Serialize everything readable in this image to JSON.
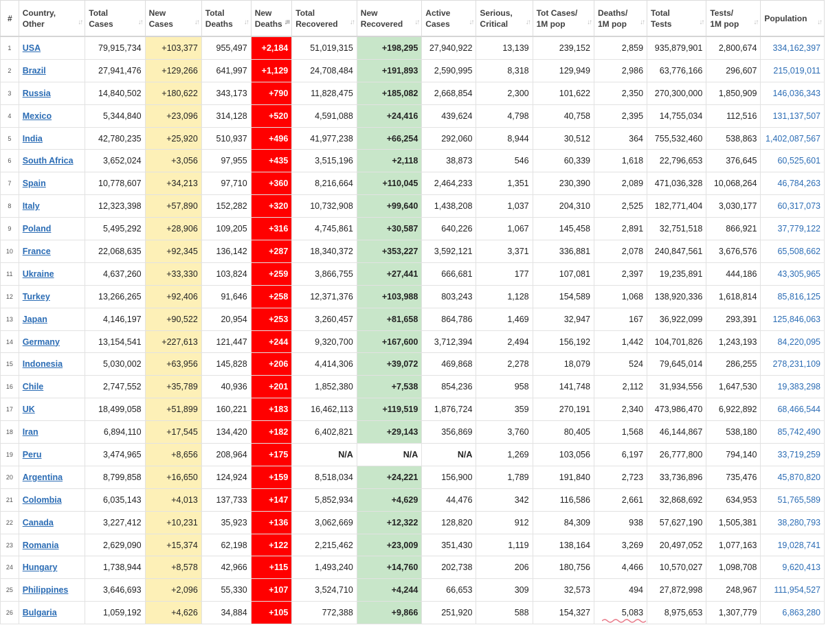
{
  "columns": [
    {
      "line1": "#",
      "line2": "",
      "sort": ""
    },
    {
      "line1": "Country,",
      "line2": "Other",
      "sort": "↓↑"
    },
    {
      "line1": "Total",
      "line2": "Cases",
      "sort": "↓↑"
    },
    {
      "line1": "New",
      "line2": "Cases",
      "sort": "↓↑"
    },
    {
      "line1": "Total",
      "line2": "Deaths",
      "sort": "↓↑"
    },
    {
      "line1": "New",
      "line2": "Deaths",
      "sort": "↓≡"
    },
    {
      "line1": "Total",
      "line2": "Recovered",
      "sort": "↓↑"
    },
    {
      "line1": "New",
      "line2": "Recovered",
      "sort": "↓↑"
    },
    {
      "line1": "Active",
      "line2": "Cases",
      "sort": "↓↑"
    },
    {
      "line1": "Serious,",
      "line2": "Critical",
      "sort": "↓↑"
    },
    {
      "line1": "Tot Cases/",
      "line2": "1M pop",
      "sort": "↓↑"
    },
    {
      "line1": "Deaths/",
      "line2": "1M pop",
      "sort": "↓↑"
    },
    {
      "line1": "Total",
      "line2": "Tests",
      "sort": "↓↑"
    },
    {
      "line1": "Tests/",
      "line2": "1M pop",
      "sort": "↓↑"
    },
    {
      "line1": "Population",
      "line2": "",
      "sort": "↓↑"
    }
  ],
  "rows": [
    {
      "rank": "1",
      "country": "USA",
      "total_cases": "79,915,734",
      "new_cases": "+103,377",
      "total_deaths": "955,497",
      "new_deaths": "+2,184",
      "total_recovered": "51,019,315",
      "new_recovered": "+198,295",
      "active_cases": "27,940,922",
      "critical": "13,139",
      "cases_per_1m": "239,152",
      "deaths_per_1m": "2,859",
      "total_tests": "935,879,901",
      "tests_per_1m": "2,800,674",
      "population": "334,162,397"
    },
    {
      "rank": "2",
      "country": "Brazil",
      "total_cases": "27,941,476",
      "new_cases": "+129,266",
      "total_deaths": "641,997",
      "new_deaths": "+1,129",
      "total_recovered": "24,708,484",
      "new_recovered": "+191,893",
      "active_cases": "2,590,995",
      "critical": "8,318",
      "cases_per_1m": "129,949",
      "deaths_per_1m": "2,986",
      "total_tests": "63,776,166",
      "tests_per_1m": "296,607",
      "population": "215,019,011"
    },
    {
      "rank": "3",
      "country": "Russia",
      "total_cases": "14,840,502",
      "new_cases": "+180,622",
      "total_deaths": "343,173",
      "new_deaths": "+790",
      "total_recovered": "11,828,475",
      "new_recovered": "+185,082",
      "active_cases": "2,668,854",
      "critical": "2,300",
      "cases_per_1m": "101,622",
      "deaths_per_1m": "2,350",
      "total_tests": "270,300,000",
      "tests_per_1m": "1,850,909",
      "population": "146,036,343"
    },
    {
      "rank": "4",
      "country": "Mexico",
      "total_cases": "5,344,840",
      "new_cases": "+23,096",
      "total_deaths": "314,128",
      "new_deaths": "+520",
      "total_recovered": "4,591,088",
      "new_recovered": "+24,416",
      "active_cases": "439,624",
      "critical": "4,798",
      "cases_per_1m": "40,758",
      "deaths_per_1m": "2,395",
      "total_tests": "14,755,034",
      "tests_per_1m": "112,516",
      "population": "131,137,507"
    },
    {
      "rank": "5",
      "country": "India",
      "total_cases": "42,780,235",
      "new_cases": "+25,920",
      "total_deaths": "510,937",
      "new_deaths": "+496",
      "total_recovered": "41,977,238",
      "new_recovered": "+66,254",
      "active_cases": "292,060",
      "critical": "8,944",
      "cases_per_1m": "30,512",
      "deaths_per_1m": "364",
      "total_tests": "755,532,460",
      "tests_per_1m": "538,863",
      "population": "1,402,087,567"
    },
    {
      "rank": "6",
      "country": "South Africa",
      "total_cases": "3,652,024",
      "new_cases": "+3,056",
      "total_deaths": "97,955",
      "new_deaths": "+435",
      "total_recovered": "3,515,196",
      "new_recovered": "+2,118",
      "active_cases": "38,873",
      "critical": "546",
      "cases_per_1m": "60,339",
      "deaths_per_1m": "1,618",
      "total_tests": "22,796,653",
      "tests_per_1m": "376,645",
      "population": "60,525,601"
    },
    {
      "rank": "7",
      "country": "Spain",
      "total_cases": "10,778,607",
      "new_cases": "+34,213",
      "total_deaths": "97,710",
      "new_deaths": "+360",
      "total_recovered": "8,216,664",
      "new_recovered": "+110,045",
      "active_cases": "2,464,233",
      "critical": "1,351",
      "cases_per_1m": "230,390",
      "deaths_per_1m": "2,089",
      "total_tests": "471,036,328",
      "tests_per_1m": "10,068,264",
      "population": "46,784,263"
    },
    {
      "rank": "8",
      "country": "Italy",
      "total_cases": "12,323,398",
      "new_cases": "+57,890",
      "total_deaths": "152,282",
      "new_deaths": "+320",
      "total_recovered": "10,732,908",
      "new_recovered": "+99,640",
      "active_cases": "1,438,208",
      "critical": "1,037",
      "cases_per_1m": "204,310",
      "deaths_per_1m": "2,525",
      "total_tests": "182,771,404",
      "tests_per_1m": "3,030,177",
      "population": "60,317,073"
    },
    {
      "rank": "9",
      "country": "Poland",
      "total_cases": "5,495,292",
      "new_cases": "+28,906",
      "total_deaths": "109,205",
      "new_deaths": "+316",
      "total_recovered": "4,745,861",
      "new_recovered": "+30,587",
      "active_cases": "640,226",
      "critical": "1,067",
      "cases_per_1m": "145,458",
      "deaths_per_1m": "2,891",
      "total_tests": "32,751,518",
      "tests_per_1m": "866,921",
      "population": "37,779,122"
    },
    {
      "rank": "10",
      "country": "France",
      "total_cases": "22,068,635",
      "new_cases": "+92,345",
      "total_deaths": "136,142",
      "new_deaths": "+287",
      "total_recovered": "18,340,372",
      "new_recovered": "+353,227",
      "active_cases": "3,592,121",
      "critical": "3,371",
      "cases_per_1m": "336,881",
      "deaths_per_1m": "2,078",
      "total_tests": "240,847,561",
      "tests_per_1m": "3,676,576",
      "population": "65,508,662"
    },
    {
      "rank": "11",
      "country": "Ukraine",
      "total_cases": "4,637,260",
      "new_cases": "+33,330",
      "total_deaths": "103,824",
      "new_deaths": "+259",
      "total_recovered": "3,866,755",
      "new_recovered": "+27,441",
      "active_cases": "666,681",
      "critical": "177",
      "cases_per_1m": "107,081",
      "deaths_per_1m": "2,397",
      "total_tests": "19,235,891",
      "tests_per_1m": "444,186",
      "population": "43,305,965"
    },
    {
      "rank": "12",
      "country": "Turkey",
      "total_cases": "13,266,265",
      "new_cases": "+92,406",
      "total_deaths": "91,646",
      "new_deaths": "+258",
      "total_recovered": "12,371,376",
      "new_recovered": "+103,988",
      "active_cases": "803,243",
      "critical": "1,128",
      "cases_per_1m": "154,589",
      "deaths_per_1m": "1,068",
      "total_tests": "138,920,336",
      "tests_per_1m": "1,618,814",
      "population": "85,816,125"
    },
    {
      "rank": "13",
      "country": "Japan",
      "total_cases": "4,146,197",
      "new_cases": "+90,522",
      "total_deaths": "20,954",
      "new_deaths": "+253",
      "total_recovered": "3,260,457",
      "new_recovered": "+81,658",
      "active_cases": "864,786",
      "critical": "1,469",
      "cases_per_1m": "32,947",
      "deaths_per_1m": "167",
      "total_tests": "36,922,099",
      "tests_per_1m": "293,391",
      "population": "125,846,063"
    },
    {
      "rank": "14",
      "country": "Germany",
      "total_cases": "13,154,541",
      "new_cases": "+227,613",
      "total_deaths": "121,447",
      "new_deaths": "+244",
      "total_recovered": "9,320,700",
      "new_recovered": "+167,600",
      "active_cases": "3,712,394",
      "critical": "2,494",
      "cases_per_1m": "156,192",
      "deaths_per_1m": "1,442",
      "total_tests": "104,701,826",
      "tests_per_1m": "1,243,193",
      "population": "84,220,095"
    },
    {
      "rank": "15",
      "country": "Indonesia",
      "total_cases": "5,030,002",
      "new_cases": "+63,956",
      "total_deaths": "145,828",
      "new_deaths": "+206",
      "total_recovered": "4,414,306",
      "new_recovered": "+39,072",
      "active_cases": "469,868",
      "critical": "2,278",
      "cases_per_1m": "18,079",
      "deaths_per_1m": "524",
      "total_tests": "79,645,014",
      "tests_per_1m": "286,255",
      "population": "278,231,109"
    },
    {
      "rank": "16",
      "country": "Chile",
      "total_cases": "2,747,552",
      "new_cases": "+35,789",
      "total_deaths": "40,936",
      "new_deaths": "+201",
      "total_recovered": "1,852,380",
      "new_recovered": "+7,538",
      "active_cases": "854,236",
      "critical": "958",
      "cases_per_1m": "141,748",
      "deaths_per_1m": "2,112",
      "total_tests": "31,934,556",
      "tests_per_1m": "1,647,530",
      "population": "19,383,298"
    },
    {
      "rank": "17",
      "country": "UK",
      "total_cases": "18,499,058",
      "new_cases": "+51,899",
      "total_deaths": "160,221",
      "new_deaths": "+183",
      "total_recovered": "16,462,113",
      "new_recovered": "+119,519",
      "active_cases": "1,876,724",
      "critical": "359",
      "cases_per_1m": "270,191",
      "deaths_per_1m": "2,340",
      "total_tests": "473,986,470",
      "tests_per_1m": "6,922,892",
      "population": "68,466,544"
    },
    {
      "rank": "18",
      "country": "Iran",
      "total_cases": "6,894,110",
      "new_cases": "+17,545",
      "total_deaths": "134,420",
      "new_deaths": "+182",
      "total_recovered": "6,402,821",
      "new_recovered": "+29,143",
      "active_cases": "356,869",
      "critical": "3,760",
      "cases_per_1m": "80,405",
      "deaths_per_1m": "1,568",
      "total_tests": "46,144,867",
      "tests_per_1m": "538,180",
      "population": "85,742,490"
    },
    {
      "rank": "19",
      "country": "Peru",
      "total_cases": "3,474,965",
      "new_cases": "+8,656",
      "total_deaths": "208,964",
      "new_deaths": "+175",
      "total_recovered": "N/A",
      "new_recovered": "N/A",
      "active_cases": "N/A",
      "critical": "1,269",
      "cases_per_1m": "103,056",
      "deaths_per_1m": "6,197",
      "total_tests": "26,777,800",
      "tests_per_1m": "794,140",
      "population": "33,719,259",
      "na": true
    },
    {
      "rank": "20",
      "country": "Argentina",
      "total_cases": "8,799,858",
      "new_cases": "+16,650",
      "total_deaths": "124,924",
      "new_deaths": "+159",
      "total_recovered": "8,518,034",
      "new_recovered": "+24,221",
      "active_cases": "156,900",
      "critical": "1,789",
      "cases_per_1m": "191,840",
      "deaths_per_1m": "2,723",
      "total_tests": "33,736,896",
      "tests_per_1m": "735,476",
      "population": "45,870,820"
    },
    {
      "rank": "21",
      "country": "Colombia",
      "total_cases": "6,035,143",
      "new_cases": "+4,013",
      "total_deaths": "137,733",
      "new_deaths": "+147",
      "total_recovered": "5,852,934",
      "new_recovered": "+4,629",
      "active_cases": "44,476",
      "critical": "342",
      "cases_per_1m": "116,586",
      "deaths_per_1m": "2,661",
      "total_tests": "32,868,692",
      "tests_per_1m": "634,953",
      "population": "51,765,589"
    },
    {
      "rank": "22",
      "country": "Canada",
      "total_cases": "3,227,412",
      "new_cases": "+10,231",
      "total_deaths": "35,923",
      "new_deaths": "+136",
      "total_recovered": "3,062,669",
      "new_recovered": "+12,322",
      "active_cases": "128,820",
      "critical": "912",
      "cases_per_1m": "84,309",
      "deaths_per_1m": "938",
      "total_tests": "57,627,190",
      "tests_per_1m": "1,505,381",
      "population": "38,280,793"
    },
    {
      "rank": "23",
      "country": "Romania",
      "total_cases": "2,629,090",
      "new_cases": "+15,374",
      "total_deaths": "62,198",
      "new_deaths": "+122",
      "total_recovered": "2,215,462",
      "new_recovered": "+23,009",
      "active_cases": "351,430",
      "critical": "1,119",
      "cases_per_1m": "138,164",
      "deaths_per_1m": "3,269",
      "total_tests": "20,497,052",
      "tests_per_1m": "1,077,163",
      "population": "19,028,741"
    },
    {
      "rank": "24",
      "country": "Hungary",
      "total_cases": "1,738,944",
      "new_cases": "+8,578",
      "total_deaths": "42,966",
      "new_deaths": "+115",
      "total_recovered": "1,493,240",
      "new_recovered": "+14,760",
      "active_cases": "202,738",
      "critical": "206",
      "cases_per_1m": "180,756",
      "deaths_per_1m": "4,466",
      "total_tests": "10,570,027",
      "tests_per_1m": "1,098,708",
      "population": "9,620,413"
    },
    {
      "rank": "25",
      "country": "Philippines",
      "total_cases": "3,646,693",
      "new_cases": "+2,096",
      "total_deaths": "55,330",
      "new_deaths": "+107",
      "total_recovered": "3,524,710",
      "new_recovered": "+4,244",
      "active_cases": "66,653",
      "critical": "309",
      "cases_per_1m": "32,573",
      "deaths_per_1m": "494",
      "total_tests": "27,872,998",
      "tests_per_1m": "248,967",
      "population": "111,954,527"
    },
    {
      "rank": "26",
      "country": "Bulgaria",
      "total_cases": "1,059,192",
      "new_cases": "+4,626",
      "total_deaths": "34,884",
      "new_deaths": "+105",
      "total_recovered": "772,388",
      "new_recovered": "+9,866",
      "active_cases": "251,920",
      "critical": "588",
      "cases_per_1m": "154,327",
      "deaths_per_1m": "5,083",
      "total_tests": "8,975,653",
      "tests_per_1m": "1,307,779",
      "population": "6,863,280"
    }
  ],
  "colors": {
    "new_cases_bg": "#fdf0b7",
    "new_deaths_bg": "#ff0000",
    "new_recovered_bg": "#c8e6c9",
    "link": "#2c6db5"
  }
}
